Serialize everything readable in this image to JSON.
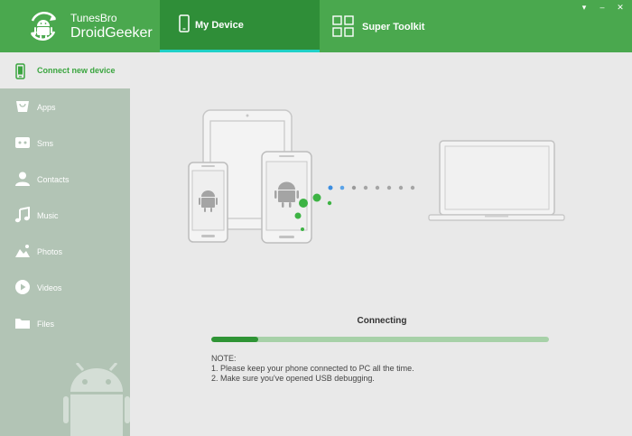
{
  "header": {
    "brand_small": "TunesBro",
    "brand_big": "DroidGeeker",
    "tabs": [
      {
        "label": "My Device",
        "active": true
      },
      {
        "label": "Super Toolkit",
        "active": false
      }
    ],
    "window_controls": [
      "▾",
      "–",
      "✕"
    ]
  },
  "sidebar": {
    "items": [
      {
        "label": "Connect new device",
        "icon": "phone-icon",
        "active": true
      },
      {
        "label": "Apps",
        "icon": "apps-icon"
      },
      {
        "label": "Sms",
        "icon": "sms-icon"
      },
      {
        "label": "Contacts",
        "icon": "contacts-icon"
      },
      {
        "label": "Music",
        "icon": "music-icon"
      },
      {
        "label": "Photos",
        "icon": "photos-icon"
      },
      {
        "label": "Videos",
        "icon": "videos-icon"
      },
      {
        "label": "Files",
        "icon": "files-icon"
      }
    ]
  },
  "main": {
    "status": "Connecting",
    "progress": 0.14,
    "note_title": "NOTE:",
    "notes": [
      "1. Please keep your phone connected to PC all the time.",
      "2. Make sure you've opened USB debugging."
    ]
  },
  "colors": {
    "header": "#4aa84e",
    "active_tab": "#2f8e38",
    "tab_underline": "#1fd1c7",
    "sidebar": "#b2c4b5",
    "progress_fill": "#2f9435",
    "progress_track": "#a7d1a8"
  }
}
